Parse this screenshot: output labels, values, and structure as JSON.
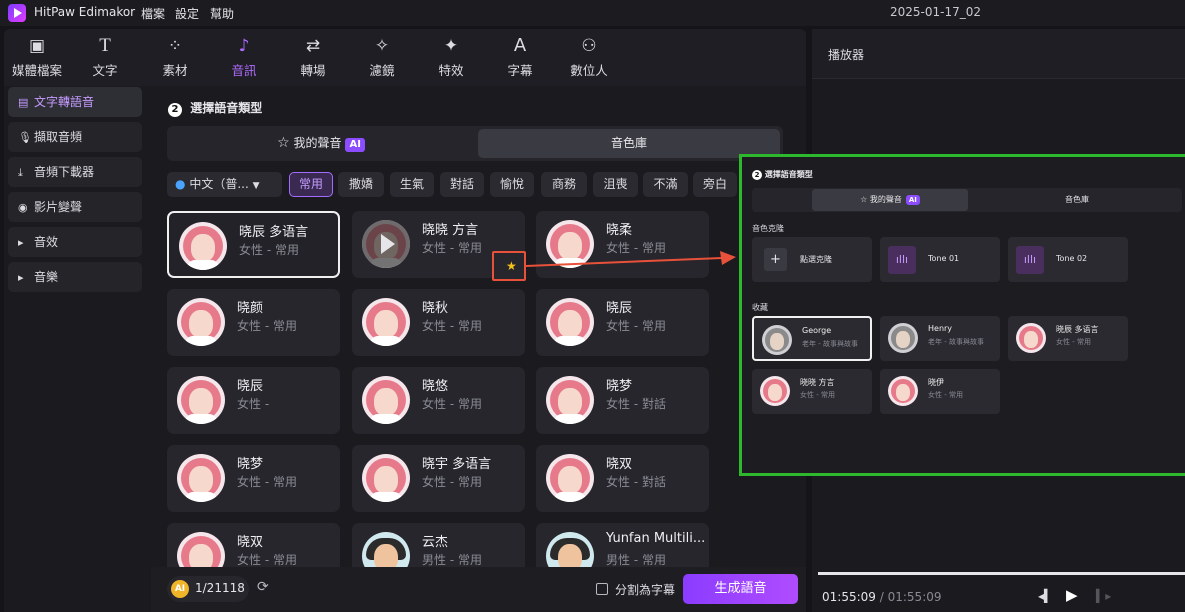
{
  "app": {
    "name": "HitPaw Edimakor",
    "menu": [
      "檔案",
      "設定",
      "幫助"
    ],
    "project_title": "2025-01-17_02"
  },
  "toolbar": {
    "tools": [
      {
        "label": "媒體檔案",
        "icon": "media-icon"
      },
      {
        "label": "文字",
        "icon": "text-icon"
      },
      {
        "label": "素材",
        "icon": "elements-icon"
      },
      {
        "label": "音訊",
        "icon": "music-note-icon",
        "active": true
      },
      {
        "label": "轉場",
        "icon": "transition-icon"
      },
      {
        "label": "濾鏡",
        "icon": "filter-sparkle-icon"
      },
      {
        "label": "特效",
        "icon": "effects-icon"
      },
      {
        "label": "字幕",
        "icon": "subtitle-icon"
      },
      {
        "label": "數位人",
        "icon": "avatar-person-icon"
      }
    ]
  },
  "sidebar": {
    "items": [
      {
        "label": "文字轉語音",
        "active": true
      },
      {
        "label": "擷取音頻"
      },
      {
        "label": "音頻下載器"
      },
      {
        "label": "影片變聲"
      },
      {
        "label": "音效"
      },
      {
        "label": "音樂"
      }
    ]
  },
  "main": {
    "step_number": "2",
    "step_title": "選擇語音類型",
    "tabs": {
      "my_voice": "我的聲音",
      "ai_badge": "AI",
      "library": "音色庫"
    },
    "language": "中文（普...",
    "filters": [
      "常用",
      "撒嬌",
      "生氣",
      "對話",
      "愉悅",
      "商務",
      "沮喪",
      "不滿",
      "旁白"
    ],
    "voices": [
      {
        "name": "晓辰 多语言",
        "meta": "女性 - 常用",
        "selected": true
      },
      {
        "name": "晓晓 方言",
        "meta": "女性 - 常用",
        "playing": true
      },
      {
        "name": "晓柔",
        "meta": "女性 - 常用"
      },
      {
        "name": "晓颜",
        "meta": "女性 - 常用"
      },
      {
        "name": "晓秋",
        "meta": "女性 - 常用"
      },
      {
        "name": "晓辰",
        "meta": "女性 - 常用"
      },
      {
        "name": "晓辰",
        "meta": "女性 -"
      },
      {
        "name": "晓悠",
        "meta": "女性 - 常用"
      },
      {
        "name": "晓梦",
        "meta": "女性 - 對話"
      },
      {
        "name": "晓梦",
        "meta": "女性 - 常用"
      },
      {
        "name": "晓宇 多语言",
        "meta": "女性 - 常用"
      },
      {
        "name": "晓双",
        "meta": "女性 - 對話"
      },
      {
        "name": "晓双",
        "meta": "女性 - 常用"
      },
      {
        "name": "云杰",
        "meta": "男性 - 常用",
        "male": true
      },
      {
        "name": "Yunfan Multili...",
        "meta": "男性 - 常用",
        "male": true
      }
    ]
  },
  "bottom": {
    "credits": "1/21118",
    "split_label": "分割為字幕",
    "generate_label": "生成語音"
  },
  "player": {
    "title": "播放器",
    "time_current": "01:55:09",
    "time_separator": "/",
    "time_total": "01:55:09"
  },
  "overlay": {
    "step_number": "2",
    "step_title": "選擇語音類型",
    "my_voice": "我的聲音",
    "ai_badge": "AI",
    "library": "音色庫",
    "clone_section": "音色克隆",
    "clone_button": "點選克隆",
    "tones": [
      "Tone 01",
      "Tone 02"
    ],
    "favorites_section": "收藏",
    "favorites": [
      {
        "name": "George",
        "meta": "老年 - 故事與故事",
        "gray": true,
        "selected": true
      },
      {
        "name": "Henry",
        "meta": "老年 - 故事與故事",
        "gray": true
      },
      {
        "name": "晓辰 多语言",
        "meta": "女性 - 常用"
      },
      {
        "name": "晓晓 方言",
        "meta": "女性 - 常用"
      },
      {
        "name": "晓伊",
        "meta": "女性 - 常用"
      }
    ]
  },
  "colors": {
    "accent": "#a46bff",
    "highlight_box": "#2eb82e",
    "arrow": "#e8513a",
    "star": "#f2c21b"
  }
}
